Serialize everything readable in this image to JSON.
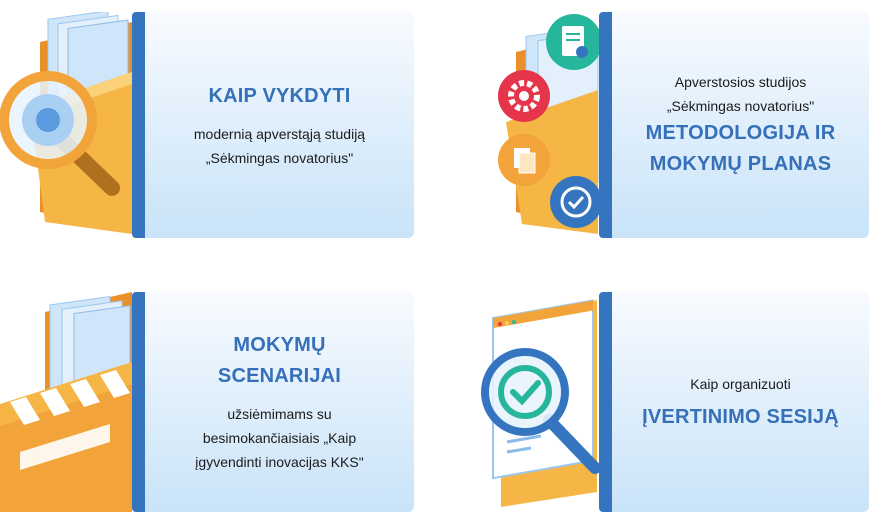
{
  "cards": [
    {
      "heading": "KAIP VYKDYTI",
      "line1": "modernią apverstąją studiją",
      "line2": "„Sėkmingas novatorius\""
    },
    {
      "intro1": "Apverstosios studijos",
      "intro2": "„Sėkmingas novatorius\"",
      "heading1": "METODOLOGIJA IR",
      "heading2": "MOKYMŲ PLANAS"
    },
    {
      "heading1": "MOKYMŲ",
      "heading2": "SCENARIJAI",
      "line1": "užsiėmimams su",
      "line2": "besimokančiaisiais „Kaip",
      "line3": "įgyvendinti inovacijas KKS\""
    },
    {
      "intro": "Kaip organizuoti",
      "heading": "ĮVERTINIMO SESIJĄ"
    }
  ],
  "colors": {
    "accent_bar": "#3575bf",
    "heading_text": "#3570b8",
    "panel_light": "#f8fbff",
    "panel_dark": "#c9e3f8",
    "folder_orange": "#f2a43a"
  },
  "icons": [
    "magnifier-folder-illustration",
    "gear-icon",
    "document-icon",
    "copy-icon",
    "checkmark-icon",
    "clapperboard-illustration",
    "magnifier-checkmark-illustration"
  ]
}
